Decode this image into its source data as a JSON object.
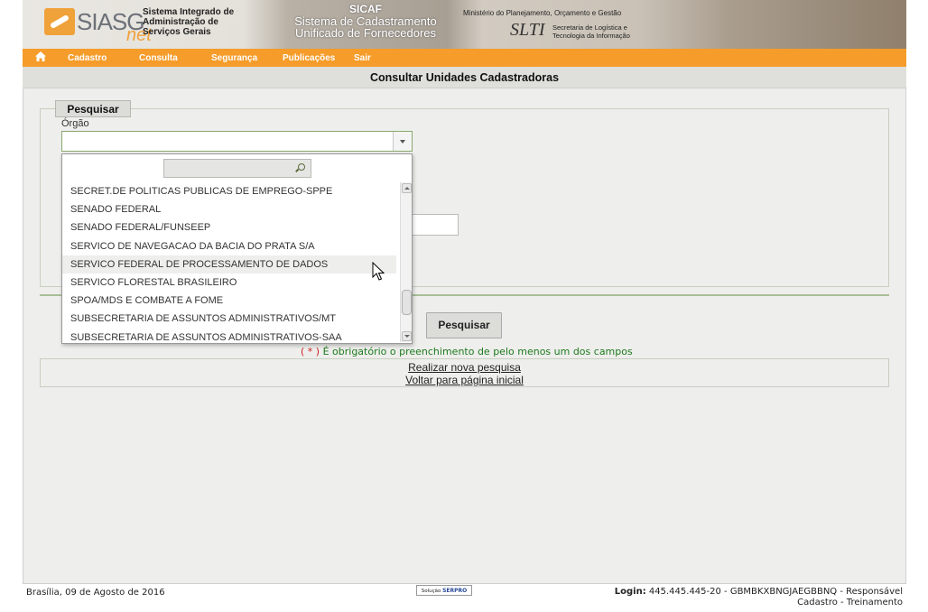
{
  "banner": {
    "logo_text": "SIASG",
    "logo_suffix": "net",
    "system_name_lines": [
      "Sistema Integrado de",
      "Administração de",
      "Serviços Gerais"
    ],
    "sicaf_title": "SICAF",
    "sicaf_subtitle_lines": [
      "Sistema de Cadastramento",
      "Unificado de Fornecedores"
    ],
    "ministry": "Ministério do Planejamento, Orçamento e Gestão",
    "slti": "SLTI",
    "slti_sub_lines": [
      "Secretaria de Logística e",
      "Tecnologia da Informação"
    ]
  },
  "menu": {
    "home_icon": "home-icon",
    "items": [
      "Cadastro",
      "Consulta",
      "Segurança",
      "Publicações",
      "Sair"
    ]
  },
  "page_title": "Consultar Unidades Cadastradoras",
  "search": {
    "legend": "Pesquisar",
    "orgao_label": "Órgão",
    "orgao_value": "",
    "submit_label": "Pesquisar",
    "required_note_star": "( * )",
    "required_note_text": "É obrigatório o preenchimento de pelo menos um dos campos"
  },
  "dropdown": {
    "filter_value": "",
    "items": [
      "SECRET.DE POLITICAS PUBLICAS DE EMPREGO-SPPE",
      "SENADO FEDERAL",
      "SENADO FEDERAL/FUNSEEP",
      "SERVICO DE NAVEGACAO DA BACIA DO PRATA S/A",
      "SERVICO FEDERAL DE PROCESSAMENTO DE DADOS",
      "SERVICO FLORESTAL BRASILEIRO",
      "SPOA/MDS E COMBATE A FOME",
      "SUBSECRETARIA DE ASSUNTOS ADMINISTRATIVOS/MT",
      "SUBSECRETARIA DE ASSUNTOS ADMINISTRATIVOS-SAA"
    ],
    "hovered": "SERVICO FEDERAL DE PROCESSAMENTO DE DADOS"
  },
  "links": {
    "new_search": "Realizar nova pesquisa",
    "home": "Voltar para página inicial"
  },
  "footer": {
    "date": "Brasília, 09 de Agosto de 2016",
    "serpro_prefix": "Solução",
    "serpro_brand": "SERPRO",
    "login_label": "Login:",
    "login_value": "445.445.445-20 - GBMBKXBNGJAEGBBNQ - Responsável",
    "login_line2": "Cadastro - Treinamento"
  },
  "colors": {
    "menu_orange": "#f59c2a",
    "note_green": "#1d7a1d",
    "border_green": "#8aa86f"
  }
}
